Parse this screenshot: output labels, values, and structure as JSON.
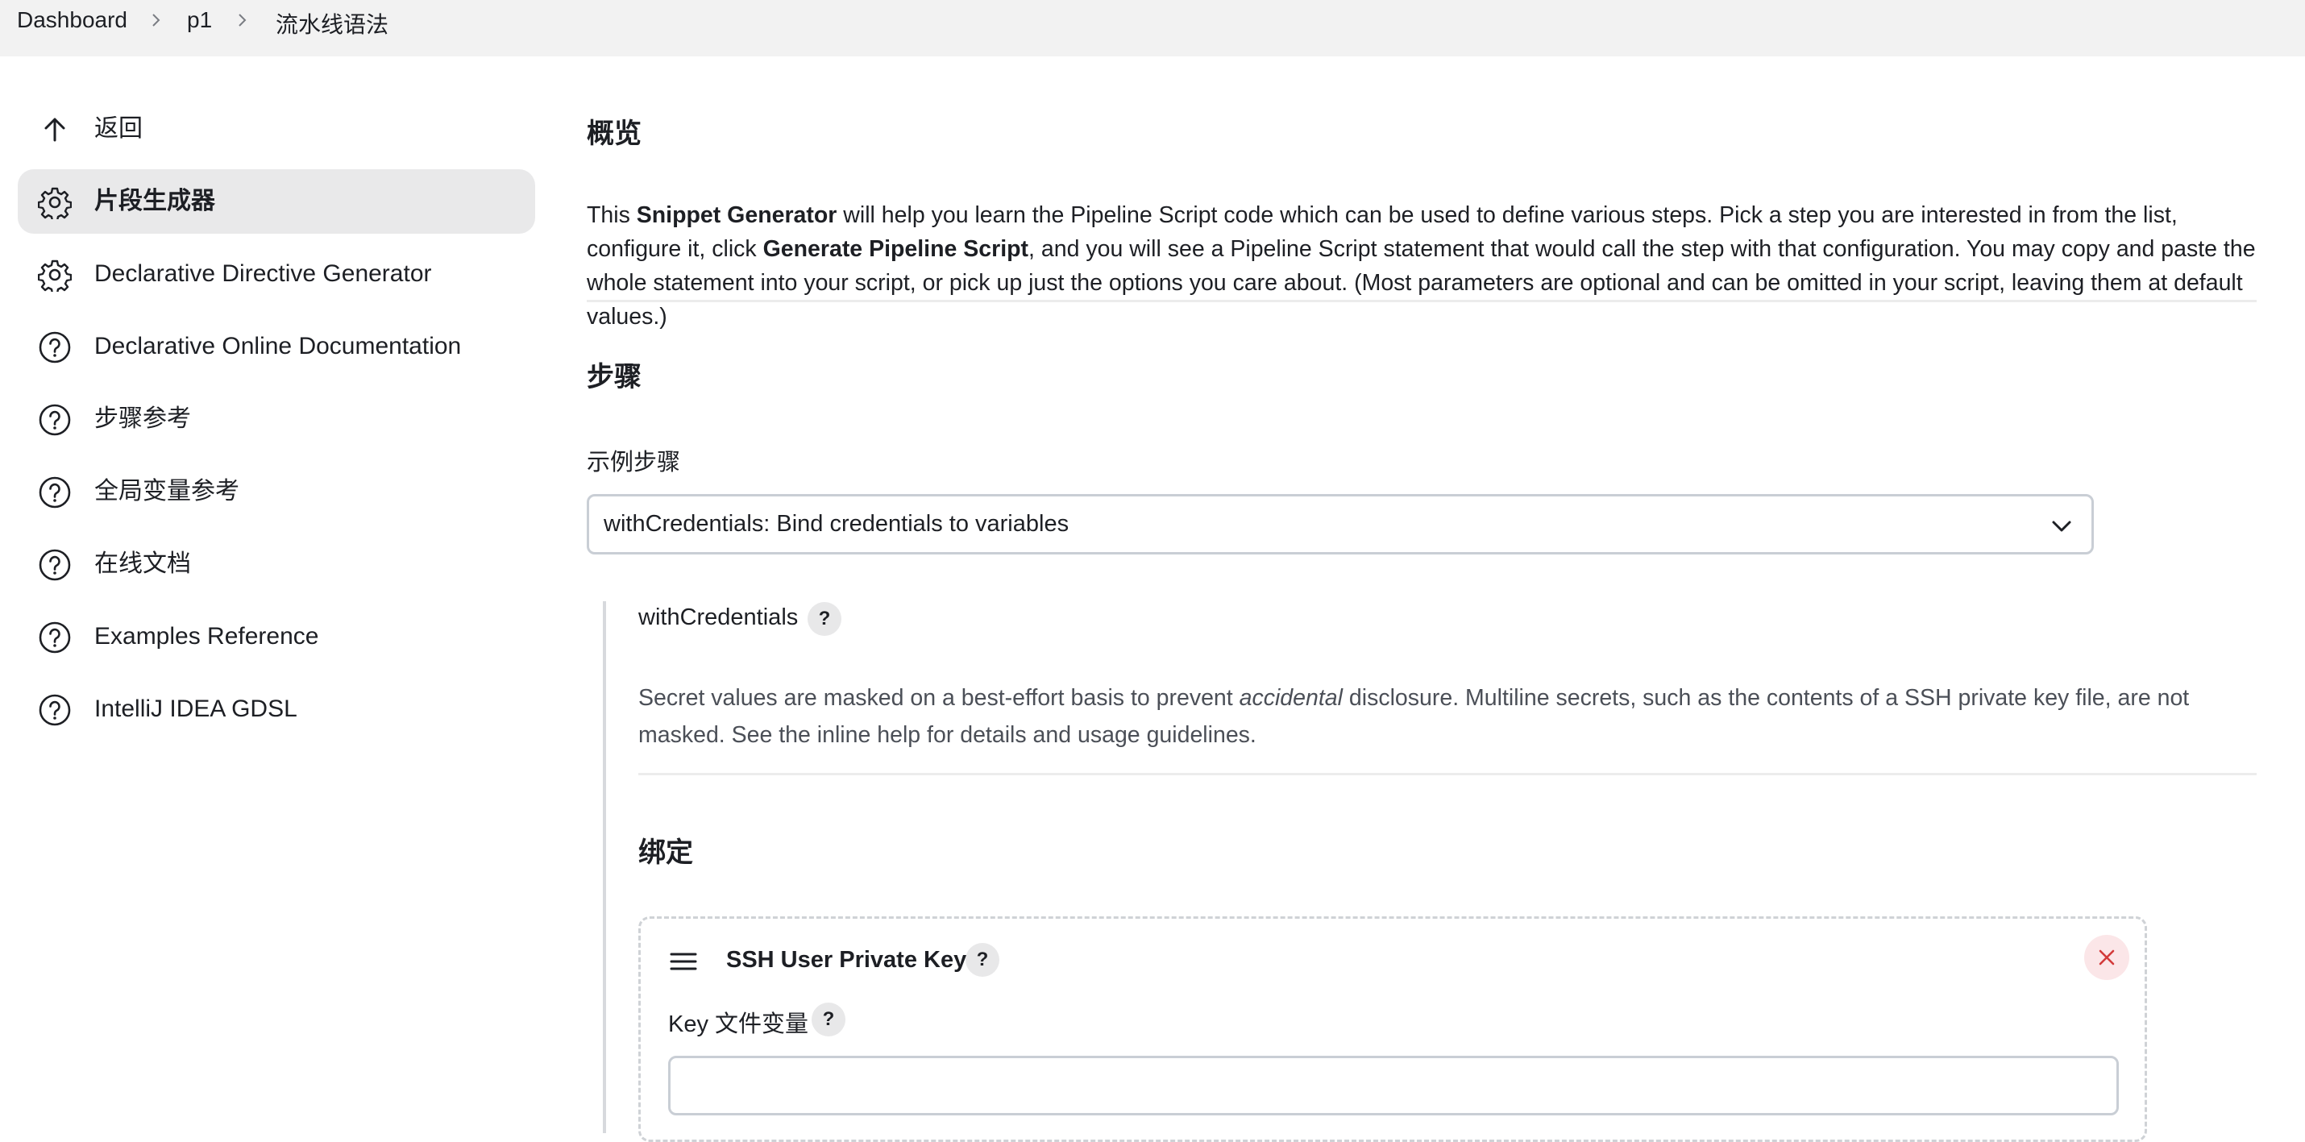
{
  "breadcrumb": [
    "Dashboard",
    "p1",
    "流水线语法"
  ],
  "sidebar": {
    "items": [
      {
        "label": "返回",
        "icon": "arrow-up-icon"
      },
      {
        "label": "片段生成器",
        "icon": "gear-icon",
        "active": true
      },
      {
        "label": "Declarative Directive Generator",
        "icon": "gear-icon"
      },
      {
        "label": "Declarative Online Documentation",
        "icon": "help-circle-icon"
      },
      {
        "label": "步骤参考",
        "icon": "help-circle-icon"
      },
      {
        "label": "全局变量参考",
        "icon": "help-circle-icon"
      },
      {
        "label": "在线文档",
        "icon": "help-circle-icon"
      },
      {
        "label": "Examples Reference",
        "icon": "help-circle-icon"
      },
      {
        "label": "IntelliJ IDEA GDSL",
        "icon": "help-circle-icon"
      }
    ]
  },
  "overview": {
    "heading": "概览",
    "text": {
      "p1": "This ",
      "b1": "Snippet Generator",
      "p2": " will help you learn the Pipeline Script code which can be used to define various steps. Pick a step you are interested in from the list, configure it, click ",
      "b2": "Generate Pipeline Script",
      "p3": ", and you will see a Pipeline Script statement that would call the step with that configuration. You may copy and paste the whole statement into your script, or pick up just the options you care about. (Most parameters are optional and can be omitted in your script, leaving them at default values.)"
    }
  },
  "steps": {
    "heading": "步骤",
    "sample_label": "示例步骤",
    "selected": "withCredentials: Bind credentials to variables",
    "step_name": "withCredentials",
    "help": "?",
    "secret_text": {
      "p1": "Secret values are masked on a best-effort basis to prevent ",
      "i1": "accidental",
      "p2": " disclosure. Multiline secrets, such as the contents of a SSH private key file, are not masked. See the inline help for details and usage guidelines."
    }
  },
  "bindings": {
    "heading": "绑定",
    "card": {
      "title": "SSH User Private Key",
      "field_label": "Key 文件变量",
      "field_value": "",
      "help": "?"
    }
  },
  "colors": {
    "close_icon": "#d33a3a",
    "close_bg": "#fbe6e8",
    "active_bg": "#e9e9ea"
  }
}
